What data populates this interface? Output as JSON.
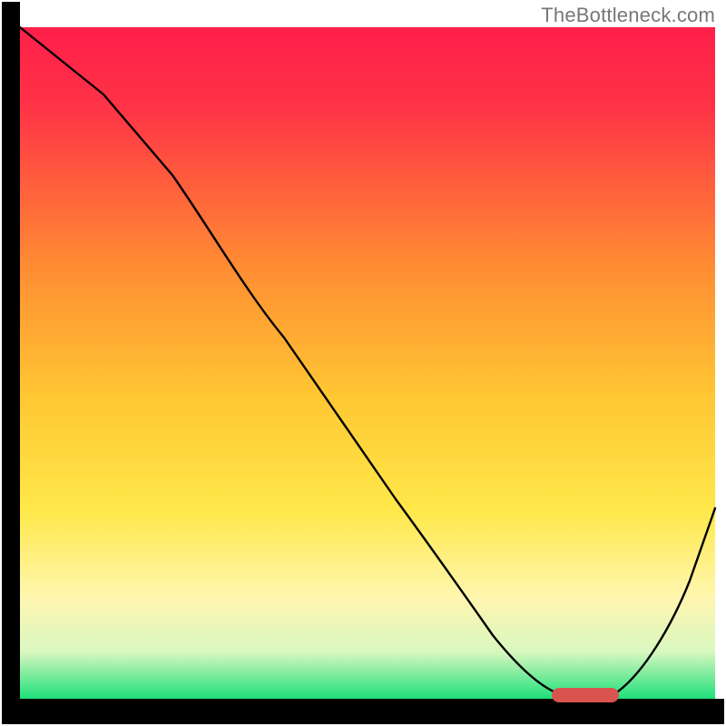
{
  "watermark": "TheBottleneck.com",
  "chart_data": {
    "type": "line",
    "title": "",
    "xlabel": "",
    "ylabel": "",
    "xlim": [
      0,
      100
    ],
    "ylim": [
      0,
      100
    ],
    "grid": false,
    "legend": false,
    "background_gradient": {
      "top_color": "#ff1f4a",
      "mid_color": "#ffd733",
      "lower_color": "#fff6b0",
      "bottom_color": "#1ee07a",
      "axis_bar_color": "#000000"
    },
    "series": [
      {
        "name": "bottleneck-curve",
        "color": "#000000",
        "stroke_width": 2.2,
        "x": [
          0,
          12,
          22,
          30,
          38,
          46,
          54,
          62,
          68,
          74,
          78,
          82,
          86,
          90,
          94,
          100
        ],
        "y": [
          100,
          90,
          78,
          68,
          58,
          48,
          38,
          28,
          18,
          10,
          4,
          1,
          1,
          8,
          18,
          34
        ]
      }
    ],
    "marker": {
      "name": "optimal-range",
      "shape": "rounded-bar",
      "color": "#d9544f",
      "x_start": 78,
      "x_end": 86,
      "y": 0.8,
      "height": 2.2
    }
  }
}
